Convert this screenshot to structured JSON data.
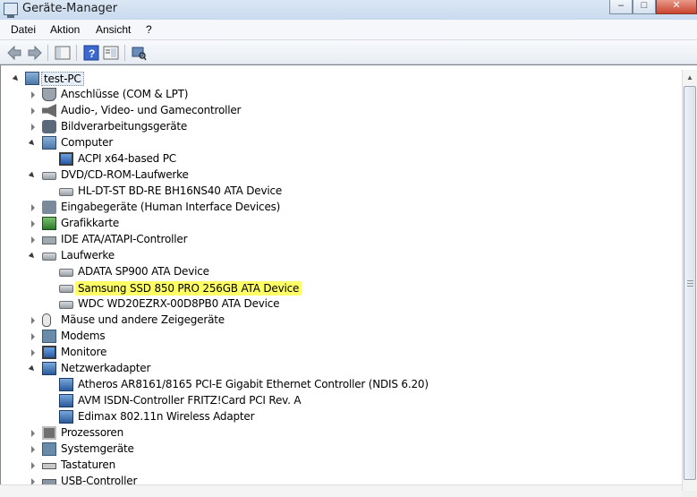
{
  "window": {
    "title": "Geräte-Manager"
  },
  "menu": [
    "Datei",
    "Aktion",
    "Ansicht",
    "?"
  ],
  "toolbar": {
    "buttons": [
      "back-arrow-icon",
      "forward-arrow-icon",
      "console-tree-icon",
      "help-icon",
      "properties-icon",
      "scan-hardware-icon"
    ]
  },
  "tree": {
    "root": "test-PC",
    "nodes": [
      {
        "label": "Anschlüsse (COM & LPT)",
        "icon": "port-icon",
        "state": "collapsed",
        "level": 1
      },
      {
        "label": "Audio-, Video- und Gamecontroller",
        "icon": "speaker-icon",
        "state": "collapsed",
        "level": 1
      },
      {
        "label": "Bildverarbeitungsgeräte",
        "icon": "camera-icon",
        "state": "collapsed",
        "level": 1
      },
      {
        "label": "Computer",
        "icon": "computer-icon",
        "state": "expanded",
        "level": 1
      },
      {
        "label": "ACPI x64-based PC",
        "icon": "monitor-icon",
        "state": "none",
        "level": 2
      },
      {
        "label": "DVD/CD-ROM-Laufwerke",
        "icon": "optical-drive-icon",
        "state": "expanded",
        "level": 1
      },
      {
        "label": "HL-DT-ST BD-RE  BH16NS40 ATA Device",
        "icon": "optical-drive-icon",
        "state": "none",
        "level": 2
      },
      {
        "label": "Eingabegeräte (Human Interface Devices)",
        "icon": "hid-icon",
        "state": "collapsed",
        "level": 1
      },
      {
        "label": "Grafikkarte",
        "icon": "graphics-card-icon",
        "state": "collapsed",
        "level": 1
      },
      {
        "label": "IDE ATA/ATAPI-Controller",
        "icon": "ide-controller-icon",
        "state": "collapsed",
        "level": 1
      },
      {
        "label": "Laufwerke",
        "icon": "disk-drive-icon",
        "state": "expanded",
        "level": 1
      },
      {
        "label": "ADATA SP900 ATA Device",
        "icon": "disk-drive-icon",
        "state": "none",
        "level": 2
      },
      {
        "label": "Samsung SSD 850 PRO 256GB ATA Device",
        "icon": "disk-drive-icon",
        "state": "none",
        "level": 2,
        "highlighted": true
      },
      {
        "label": "WDC WD20EZRX-00D8PB0 ATA Device",
        "icon": "disk-drive-icon",
        "state": "none",
        "level": 2
      },
      {
        "label": "Mäuse und andere Zeigegeräte",
        "icon": "mouse-icon",
        "state": "collapsed",
        "level": 1
      },
      {
        "label": "Modems",
        "icon": "modem-icon",
        "state": "collapsed",
        "level": 1
      },
      {
        "label": "Monitore",
        "icon": "monitor-icon",
        "state": "collapsed",
        "level": 1
      },
      {
        "label": "Netzwerkadapter",
        "icon": "network-adapter-icon",
        "state": "expanded",
        "level": 1
      },
      {
        "label": "Atheros AR8161/8165 PCI-E Gigabit Ethernet Controller (NDIS 6.20)",
        "icon": "network-adapter-icon",
        "state": "none",
        "level": 2
      },
      {
        "label": "AVM ISDN-Controller FRITZ!Card PCI Rev. A",
        "icon": "network-adapter-icon",
        "state": "none",
        "level": 2
      },
      {
        "label": "Edimax 802.11n Wireless Adapter",
        "icon": "network-adapter-icon",
        "state": "none",
        "level": 2
      },
      {
        "label": "Prozessoren",
        "icon": "processor-icon",
        "state": "collapsed",
        "level": 1
      },
      {
        "label": "Systemgeräte",
        "icon": "system-device-icon",
        "state": "collapsed",
        "level": 1
      },
      {
        "label": "Tastaturen",
        "icon": "keyboard-icon",
        "state": "collapsed",
        "level": 1
      },
      {
        "label": "USB-Controller",
        "icon": "usb-icon",
        "state": "collapsed",
        "level": 1
      }
    ]
  },
  "colors": {
    "highlight": "#ffff66",
    "selection": "#e6eef8"
  }
}
